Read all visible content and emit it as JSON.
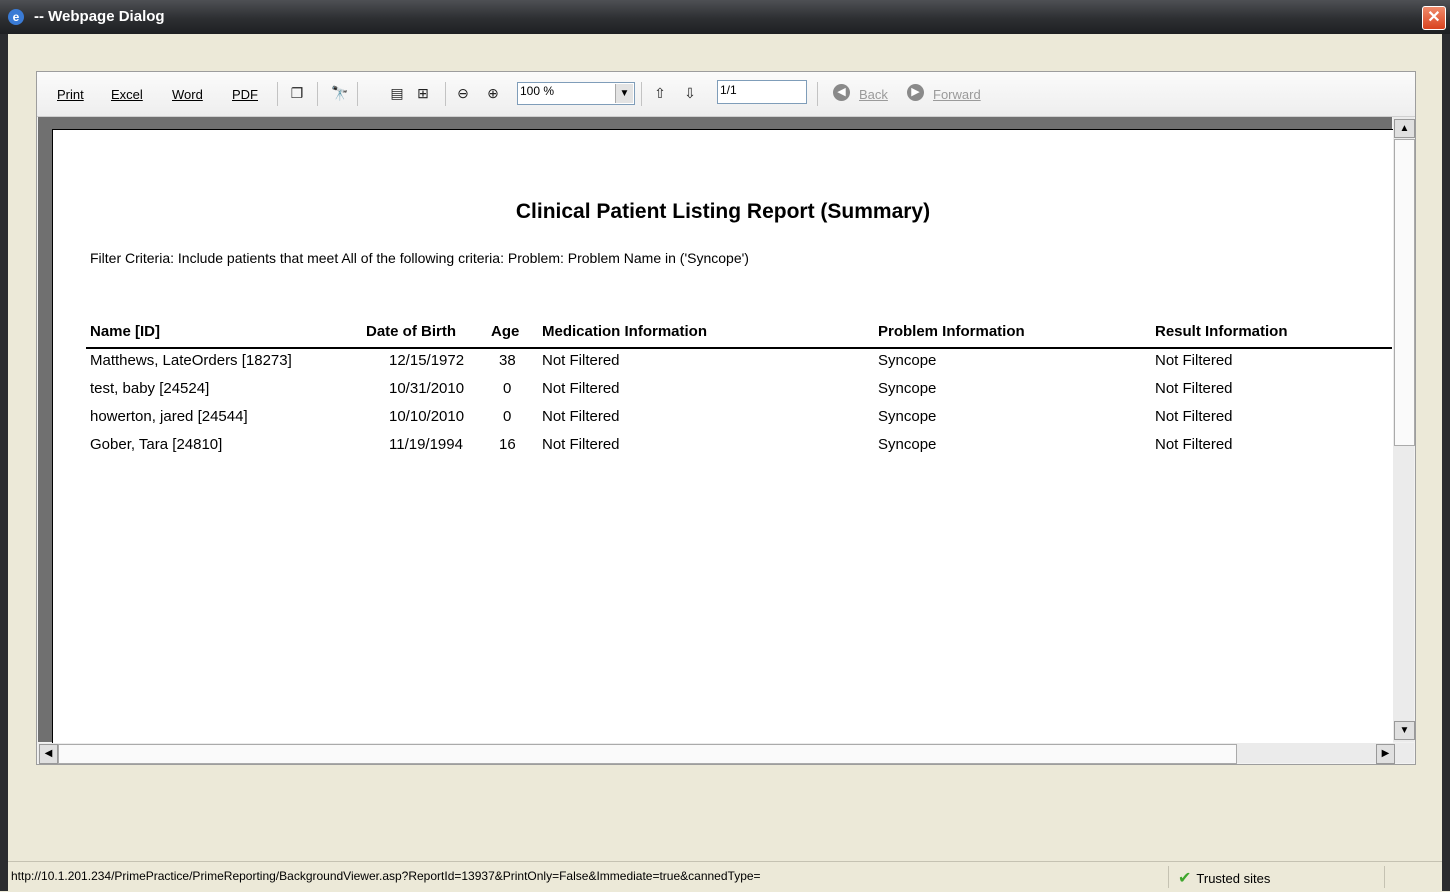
{
  "window": {
    "title": "-- Webpage Dialog",
    "close_glyph": "✕",
    "ie_glyph": "e"
  },
  "toolbar": {
    "print": "Print",
    "excel": "Excel",
    "word": "Word",
    "pdf": "PDF",
    "zoom_value": "100 %",
    "page_value": "1/1",
    "back": "Back",
    "forward": "Forward"
  },
  "report": {
    "title": "Clinical Patient Listing Report (Summary)",
    "filter": "Filter Criteria: Include patients that meet All of the following criteria: Problem: Problem Name in ('Syncope')",
    "columns": {
      "name": "Name [ID]",
      "dob": "Date of Birth",
      "age": "Age",
      "medication": "Medication Information",
      "problem": "Problem Information",
      "result": "Result Information"
    },
    "rows": [
      {
        "name": "Matthews, LateOrders [18273]",
        "dob": "12/15/1972",
        "age": "38",
        "medication": "Not Filtered",
        "problem": "Syncope",
        "result": "Not Filtered"
      },
      {
        "name": "test, baby [24524]",
        "dob": "10/31/2010",
        "age": "0",
        "medication": "Not Filtered",
        "problem": "Syncope",
        "result": "Not Filtered"
      },
      {
        "name": "howerton, jared [24544]",
        "dob": "10/10/2010",
        "age": "0",
        "medication": "Not Filtered",
        "problem": "Syncope",
        "result": "Not Filtered"
      },
      {
        "name": "Gober, Tara [24810]",
        "dob": "11/19/1994",
        "age": "16",
        "medication": "Not Filtered",
        "problem": "Syncope",
        "result": "Not Filtered"
      }
    ]
  },
  "statusbar": {
    "url": "http://10.1.201.234/PrimePractice/PrimeReporting/BackgroundViewer.asp?ReportId=13937&PrintOnly=False&Immediate=true&cannedType=",
    "zone": "Trusted sites"
  }
}
